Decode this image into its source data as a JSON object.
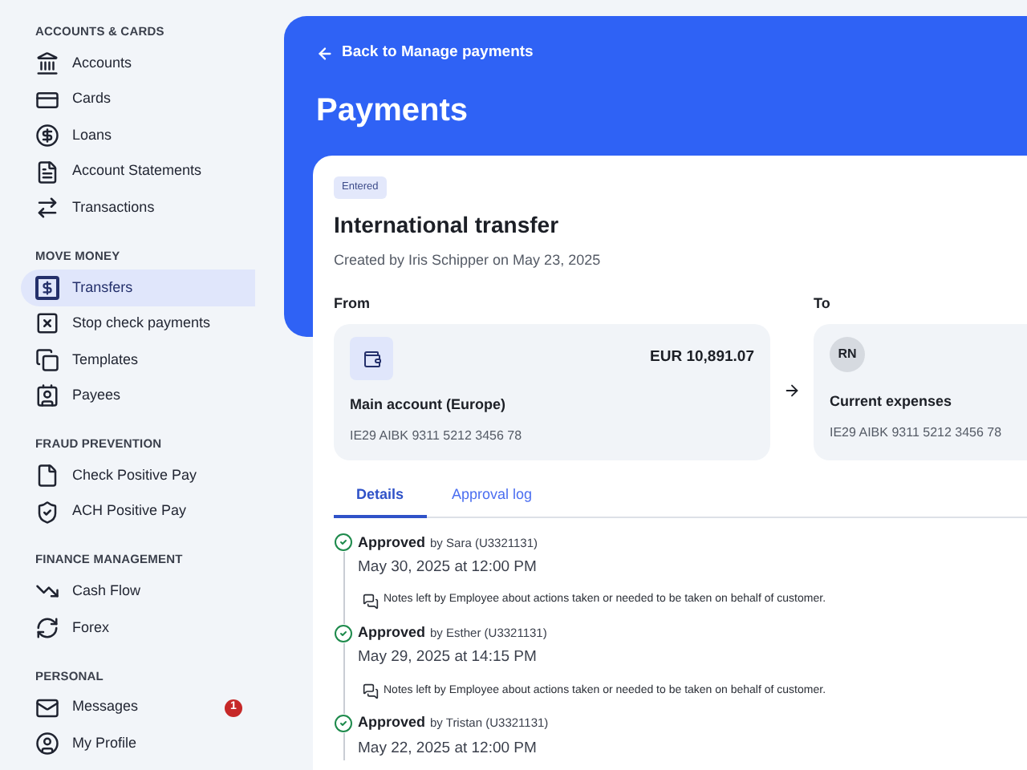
{
  "sidebar": {
    "sections": [
      {
        "title": "ACCOUNTS & CARDS",
        "items": [
          {
            "label": "Accounts",
            "selected": false
          },
          {
            "label": "Cards",
            "selected": false
          },
          {
            "label": "Loans",
            "selected": false
          },
          {
            "label": "Account Statements",
            "selected": false
          },
          {
            "label": "Transactions",
            "selected": false
          }
        ]
      },
      {
        "title": "MOVE MONEY",
        "items": [
          {
            "label": "Transfers",
            "selected": true
          },
          {
            "label": "Stop check payments",
            "selected": false
          },
          {
            "label": "Templates",
            "selected": false
          },
          {
            "label": "Payees",
            "selected": false
          }
        ]
      },
      {
        "title": "FRAUD PREVENTION",
        "items": [
          {
            "label": "Check Positive Pay",
            "selected": false
          },
          {
            "label": "ACH Positive Pay",
            "selected": false
          }
        ]
      },
      {
        "title": "FINANCE MANAGEMENT",
        "items": [
          {
            "label": "Cash Flow",
            "selected": false
          },
          {
            "label": "Forex",
            "selected": false
          }
        ]
      },
      {
        "title": "PERSONAL",
        "items": [
          {
            "label": "Messages",
            "selected": false,
            "badge": "1"
          },
          {
            "label": "My Profile",
            "selected": false
          }
        ]
      }
    ]
  },
  "header": {
    "back_link": "Back to Manage payments",
    "title": "Payments"
  },
  "transfer": {
    "status": "Entered",
    "title": "International transfer",
    "created": "Created by Iris Schipper on May 23, 2025",
    "from": {
      "label": "From",
      "amount": "EUR 10,891.07",
      "name": "Main account (Europe)",
      "iban": "IE29 AIBK 9311 5212 3456 78"
    },
    "to": {
      "label": "To",
      "initials": "RN",
      "name": "Current expenses",
      "iban": "IE29 AIBK 9311 5212 3456 78"
    }
  },
  "tabs": [
    {
      "label": "Details",
      "selected": true
    },
    {
      "label": "Approval log",
      "selected": false
    }
  ],
  "approvals": [
    {
      "status": "Approved",
      "by": "by Sara (U3321131)",
      "date": "May 30, 2025 at 12:00 PM",
      "note": "Notes left by Employee about actions taken or needed to be taken on behalf of customer."
    },
    {
      "status": "Approved",
      "by": "by Esther (U3321131)",
      "date": "May 29, 2025 at 14:15 PM",
      "note": "Notes left by Employee about actions taken or needed to be taken on behalf of customer."
    },
    {
      "status": "Approved",
      "by": "by Tristan (U3321131)",
      "date": "May 22, 2025 at 12:00 PM"
    }
  ]
}
